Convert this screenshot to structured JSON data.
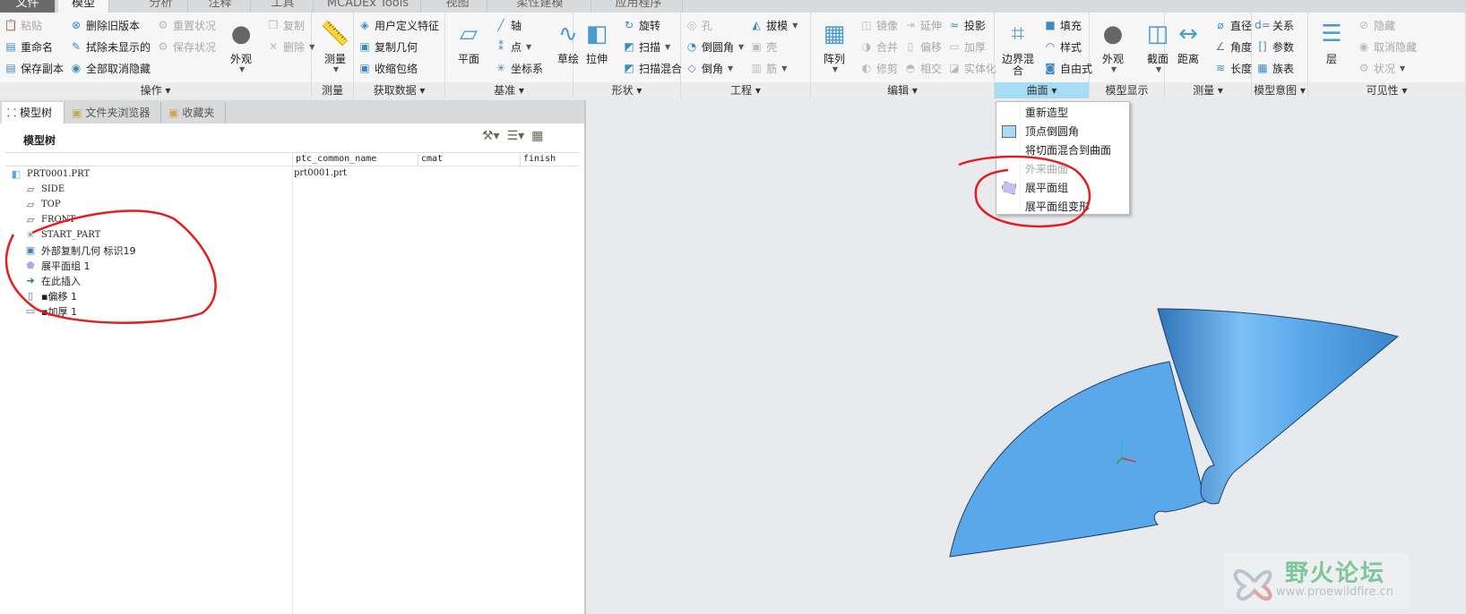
{
  "tabs": [
    {
      "label": "文件"
    },
    {
      "label": "模型"
    },
    {
      "label": "分析"
    },
    {
      "label": "注释"
    },
    {
      "label": "工具"
    },
    {
      "label": "MCADEx Tools"
    },
    {
      "label": "视图"
    },
    {
      "label": "柔性建模"
    },
    {
      "label": "应用程序"
    }
  ],
  "active_tab": "模型",
  "ribbon": {
    "groups": [
      {
        "label": "操作 ▾",
        "columns": [
          [
            {
              "label": "粘贴",
              "icon": "paste-icon",
              "disabled": true
            },
            {
              "label": "重命名",
              "icon": "rename-icon"
            },
            {
              "label": "保存副本",
              "icon": "save-copy-icon"
            }
          ],
          [
            {
              "label": "删除旧版本",
              "icon": "delete-old-versions-icon"
            },
            {
              "label": "拭除未显示的",
              "icon": "erase-icon"
            },
            {
              "label": "全部取消隐藏",
              "icon": "unhide-all-icon"
            }
          ],
          [
            {
              "label": "重置状况",
              "icon": "reset-status-icon",
              "disabled": true
            },
            {
              "label": "保存状况",
              "icon": "save-status-icon",
              "disabled": true
            }
          ],
          [
            {
              "label": "外观",
              "icon": "appearance-sphere-icon",
              "large": true,
              "dropdown": true
            }
          ],
          [
            {
              "label": "复制",
              "icon": "copy-icon",
              "disabled": true
            },
            {
              "label": "删除",
              "icon": "delete-icon",
              "disabled": true,
              "dropdown": true
            }
          ]
        ]
      },
      {
        "label": "测量",
        "columns": [
          [
            {
              "label": "测量",
              "icon": "ruler-icon",
              "large": true,
              "dropdown": true
            }
          ]
        ]
      },
      {
        "label": "获取数据 ▾",
        "columns": [
          [
            {
              "label": "用户定义特征",
              "icon": "udf-icon"
            },
            {
              "label": "复制几何",
              "icon": "copy-geometry-icon"
            },
            {
              "label": "收缩包络",
              "icon": "shrinkwrap-icon"
            }
          ]
        ]
      },
      {
        "label": "基准 ▾",
        "columns": [
          [
            {
              "label": "平面",
              "icon": "plane-icon",
              "large": true
            }
          ],
          [
            {
              "label": "轴",
              "icon": "axis-icon"
            },
            {
              "label": "点",
              "icon": "point-icon",
              "dropdown": true
            },
            {
              "label": "坐标系",
              "icon": "csys-icon"
            }
          ],
          [
            {
              "label": "草绘",
              "icon": "sketch-icon",
              "large": true
            }
          ]
        ]
      },
      {
        "label": "形状 ▾",
        "columns": [
          [
            {
              "label": "拉伸",
              "icon": "extrude-icon",
              "large": true
            }
          ],
          [
            {
              "label": "旋转",
              "icon": "revolve-icon"
            },
            {
              "label": "扫描",
              "icon": "sweep-icon",
              "dropdown": true
            },
            {
              "label": "扫描混合",
              "icon": "swept-blend-icon"
            }
          ]
        ]
      },
      {
        "label": "工程 ▾",
        "columns": [
          [
            {
              "label": "孔",
              "icon": "hole-icon",
              "disabled": true
            },
            {
              "label": "倒圆角",
              "icon": "round-icon",
              "dropdown": true
            },
            {
              "label": "倒角",
              "icon": "chamfer-icon",
              "dropdown": true
            }
          ],
          [
            {
              "label": "拔模",
              "icon": "draft-icon",
              "dropdown": true
            },
            {
              "label": "壳",
              "icon": "shell-icon",
              "disabled": true
            },
            {
              "label": "筋",
              "icon": "rib-icon",
              "disabled": true,
              "dropdown": true
            }
          ]
        ]
      },
      {
        "label": "编辑 ▾",
        "columns": [
          [
            {
              "label": "阵列",
              "icon": "pattern-icon",
              "large": true,
              "dropdown": true
            }
          ],
          [
            {
              "label": "镜像",
              "icon": "mirror-icon",
              "disabled": true
            },
            {
              "label": "合并",
              "icon": "merge-icon",
              "disabled": true
            },
            {
              "label": "修剪",
              "icon": "trim-icon",
              "disabled": true
            }
          ],
          [
            {
              "label": "延伸",
              "icon": "extend-icon",
              "disabled": true
            },
            {
              "label": "偏移",
              "icon": "offset-icon",
              "disabled": true
            },
            {
              "label": "相交",
              "icon": "intersect-icon",
              "disabled": true
            }
          ],
          [
            {
              "label": "投影",
              "icon": "project-icon"
            },
            {
              "label": "加厚",
              "icon": "thicken-icon",
              "disabled": true
            },
            {
              "label": "实体化",
              "icon": "solidify-icon",
              "disabled": true
            }
          ]
        ]
      },
      {
        "label": "曲面 ▾",
        "highlight": true,
        "columns": [
          [
            {
              "label": "边界混合",
              "icon": "boundary-blend-icon",
              "large": true
            }
          ],
          [
            {
              "label": "填充",
              "icon": "fill-icon"
            },
            {
              "label": "样式",
              "icon": "style-icon"
            },
            {
              "label": "自由式",
              "icon": "freestyle-icon"
            }
          ]
        ]
      },
      {
        "label": "模型显示",
        "columns": [
          [
            {
              "label": "外观",
              "icon": "appearance-sphere-icon",
              "large": true,
              "dropdown": true
            }
          ],
          [
            {
              "label": "截面",
              "icon": "section-icon",
              "large": true,
              "dropdown": true
            }
          ]
        ]
      },
      {
        "label": "测量 ▾",
        "columns": [
          [
            {
              "label": "距离",
              "icon": "distance-icon",
              "large": true
            }
          ],
          [
            {
              "label": "直径",
              "icon": "diameter-icon"
            },
            {
              "label": "角度",
              "icon": "angle-icon"
            },
            {
              "label": "长度",
              "icon": "length-icon"
            }
          ]
        ]
      },
      {
        "label": "模型意图 ▾",
        "columns": [
          [
            {
              "label": "关系",
              "icon": "relations-icon"
            },
            {
              "label": "参数",
              "icon": "parameters-icon"
            },
            {
              "label": "族表",
              "icon": "family-table-icon"
            }
          ]
        ]
      },
      {
        "label": "可见性 ▾",
        "columns": [
          [
            {
              "label": "层",
              "icon": "layers-icon",
              "large": true
            }
          ],
          [
            {
              "label": "隐藏",
              "icon": "hide-icon",
              "disabled": true
            },
            {
              "label": "取消隐藏",
              "icon": "unhide-icon",
              "disabled": true
            },
            {
              "label": "状况",
              "icon": "status-icon",
              "disabled": true,
              "dropdown": true
            }
          ]
        ]
      }
    ]
  },
  "panel": {
    "tabs": [
      {
        "label": "模型树"
      },
      {
        "label": "文件夹浏览器"
      },
      {
        "label": "收藏夹"
      }
    ],
    "title": "模型树",
    "columns": [
      "ptc_common_name",
      "cmat",
      "finish"
    ],
    "root_value": "prt0001.prt",
    "tree": [
      {
        "label": "PRT0001.PRT",
        "icon": "part-icon"
      },
      {
        "label": "SIDE",
        "icon": "datum-plane-icon"
      },
      {
        "label": "TOP",
        "icon": "datum-plane-icon"
      },
      {
        "label": "FRONT",
        "icon": "datum-plane-icon"
      },
      {
        "label": "START_PART",
        "icon": "csys-icon"
      },
      {
        "label": "外部复制几何 标识19",
        "icon": "external-copy-geometry-icon"
      },
      {
        "label": "展平面组 1",
        "icon": "flatten-quilt-icon"
      },
      {
        "label": "在此插入",
        "icon": "insert-here-arrow-icon"
      },
      {
        "label": "▪偏移 1",
        "icon": "offset-icon"
      },
      {
        "label": "▪加厚 1",
        "icon": "thicken-icon"
      }
    ]
  },
  "surface_menu": {
    "items": [
      {
        "label": "重新造型"
      },
      {
        "label": "顶点倒圆角",
        "icon": "vertex-round-icon"
      },
      {
        "label": "将切面混合到曲面"
      },
      {
        "label": "外来曲面",
        "disabled": true
      },
      {
        "label": "展平面组",
        "icon": "flatten-quilt-icon"
      },
      {
        "label": "展平面组变形"
      }
    ]
  },
  "watermark": {
    "title": "野火论坛",
    "url": "www.proewildfire.cn"
  },
  "colors": {
    "surface": "#5aa8ea",
    "annotation": "#e02020",
    "highlight": "#a6dcf6",
    "viewport": "#e8eaee"
  }
}
